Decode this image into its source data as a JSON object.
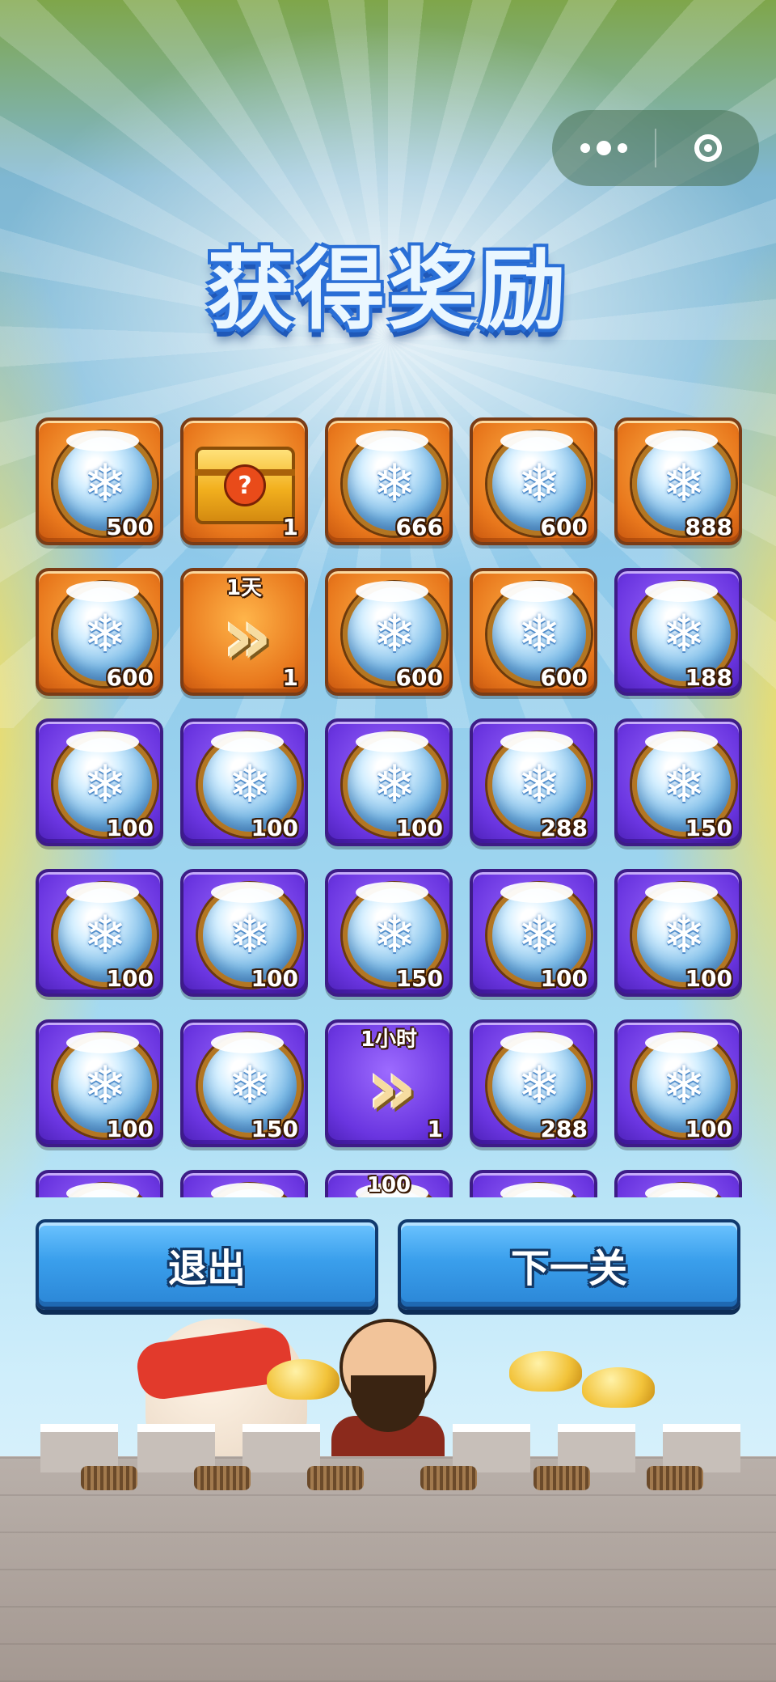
{
  "title": "获得奖励",
  "capsule": {
    "more_icon": "more-dots-icon",
    "close_icon": "target-close-icon"
  },
  "rewards": [
    [
      {
        "type": "orb",
        "frame": "orange",
        "count": "500"
      },
      {
        "type": "chest",
        "frame": "orange",
        "count": "1"
      },
      {
        "type": "orb",
        "frame": "orange",
        "count": "666"
      },
      {
        "type": "orb",
        "frame": "orange",
        "count": "600"
      },
      {
        "type": "orb",
        "frame": "orange",
        "count": "888"
      }
    ],
    [
      {
        "type": "orb",
        "frame": "orange",
        "count": "600"
      },
      {
        "type": "speedup",
        "frame": "orange",
        "count": "1",
        "note": "1天"
      },
      {
        "type": "orb",
        "frame": "orange",
        "count": "600"
      },
      {
        "type": "orb",
        "frame": "orange",
        "count": "600"
      },
      {
        "type": "orb",
        "frame": "purple",
        "count": "188"
      }
    ],
    [
      {
        "type": "orb",
        "frame": "purple",
        "count": "100"
      },
      {
        "type": "orb",
        "frame": "purple",
        "count": "100"
      },
      {
        "type": "orb",
        "frame": "purple",
        "count": "100"
      },
      {
        "type": "orb",
        "frame": "purple",
        "count": "288"
      },
      {
        "type": "orb",
        "frame": "purple",
        "count": "150"
      }
    ],
    [
      {
        "type": "orb",
        "frame": "purple",
        "count": "100"
      },
      {
        "type": "orb",
        "frame": "purple",
        "count": "100"
      },
      {
        "type": "orb",
        "frame": "purple",
        "count": "150"
      },
      {
        "type": "orb",
        "frame": "purple",
        "count": "100"
      },
      {
        "type": "orb",
        "frame": "purple",
        "count": "100"
      }
    ],
    [
      {
        "type": "orb",
        "frame": "purple",
        "count": "100"
      },
      {
        "type": "orb",
        "frame": "purple",
        "count": "150"
      },
      {
        "type": "speedup",
        "frame": "purple",
        "count": "1",
        "note": "1小时"
      },
      {
        "type": "orb",
        "frame": "purple",
        "count": "288"
      },
      {
        "type": "orb",
        "frame": "purple",
        "count": "100"
      }
    ],
    [
      {
        "type": "orb",
        "frame": "purple",
        "count": ""
      },
      {
        "type": "orb",
        "frame": "purple",
        "count": ""
      },
      {
        "type": "orb",
        "frame": "purple",
        "count": "",
        "note": "100"
      },
      {
        "type": "orb",
        "frame": "purple",
        "count": ""
      },
      {
        "type": "orb",
        "frame": "purple",
        "count": ""
      }
    ]
  ],
  "buttons": {
    "exit": "退出",
    "next": "下一关"
  },
  "icons": {
    "orb": "snowflake-orb-icon",
    "chest": "mystery-chest-icon",
    "speedup": "speed-up-chevron-icon"
  }
}
